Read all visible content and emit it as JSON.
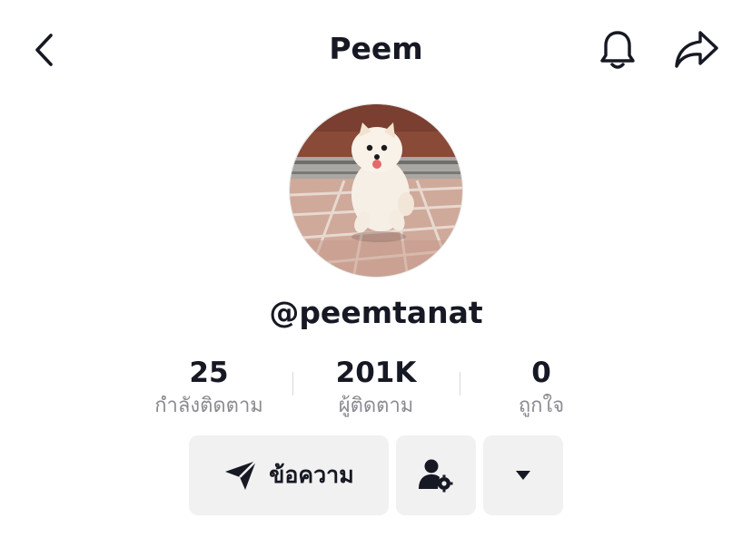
{
  "header": {
    "title": "Peem",
    "back_icon": "chevron-left-icon",
    "bell_icon": "bell-icon",
    "share_icon": "share-arrow-icon"
  },
  "profile": {
    "username": "@peemtanat",
    "avatar": "white pomeranian running on tiled pavement"
  },
  "stats": [
    {
      "value": "25",
      "label": "กำลังติดตาม"
    },
    {
      "value": "201K",
      "label": "ผู้ติดตาม"
    },
    {
      "value": "0",
      "label": "ถูกใจ"
    }
  ],
  "actions": {
    "message_label": "ข้อความ",
    "message_icon": "send-icon",
    "friends_icon": "user-settings-icon",
    "more_icon": "caret-down-icon"
  },
  "colors": {
    "text_primary": "#161823",
    "text_secondary": "#8a8b91",
    "button_bg": "#f1f1f2"
  }
}
